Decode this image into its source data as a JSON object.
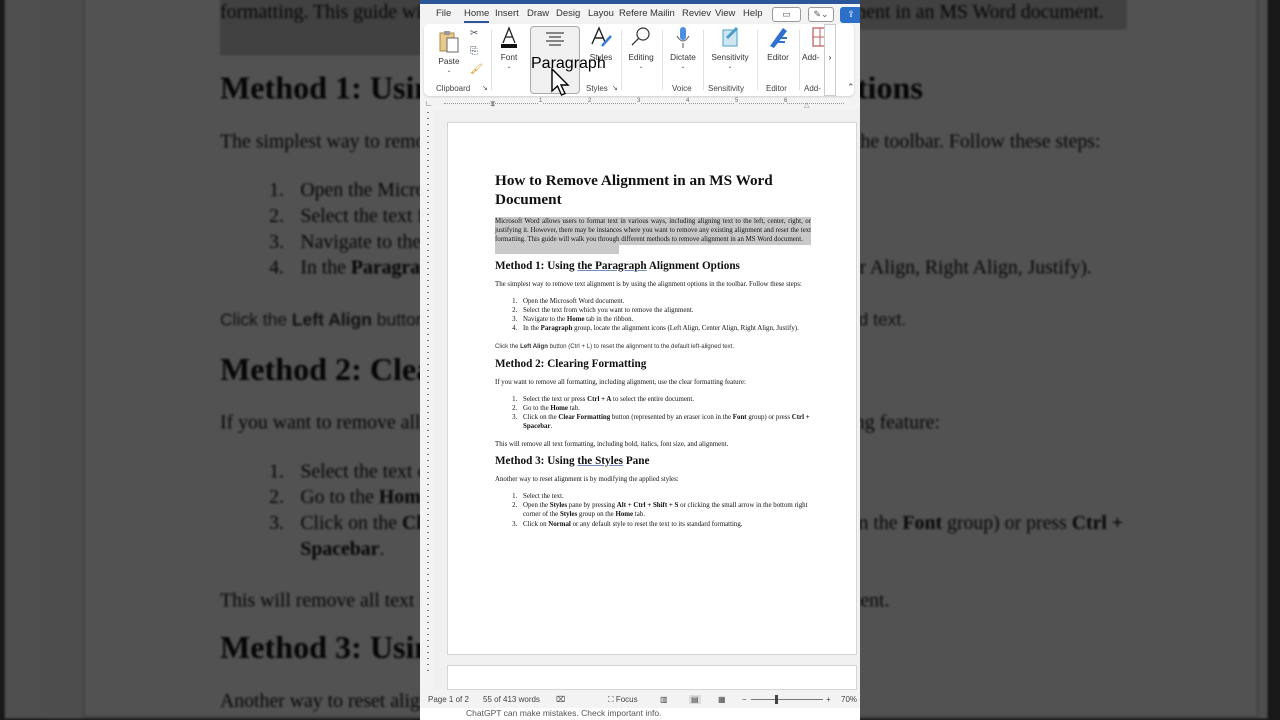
{
  "ribbon_tabs": [
    "File",
    "Home",
    "Insert",
    "Draw",
    "Desig",
    "Layou",
    "Refere",
    "Mailin",
    "Reviev",
    "View",
    "Help"
  ],
  "active_tab": "Home",
  "ribbon": {
    "paste": "Paste",
    "font": "Font",
    "paragraph": "Paragraph",
    "styles": "Styles",
    "editing": "Editing",
    "dictate": "Dictate",
    "sensitivity": "Sensitivity",
    "editor": "Editor",
    "addins": "Add-",
    "groups": {
      "clipboard": "Clipboard",
      "styles": "Styles",
      "voice": "Voice",
      "sensitivity": "Sensitivity",
      "editor": "Editor",
      "addins": "Add-"
    }
  },
  "colors": {
    "accent": "#2b579a",
    "share": "#2b6fc8",
    "selection": "#c9c9c9"
  },
  "document": {
    "title": "How to Remove Alignment in an MS Word Document",
    "intro": "Microsoft Word allows users to format text in various ways, including aligning text to the left, center, right, or justifying it. However, there may be instances where you want to remove any existing alignment and reset the text formatting. This guide will walk you through different methods to remove alignment in an MS Word document.",
    "sections": [
      {
        "heading_pre": "Method 1: Using ",
        "heading_u": "the Paragraph",
        "heading_post": " Alignment Options",
        "lead": "The simplest way to remove text alignment is by using the alignment options in the toolbar. Follow these steps:",
        "steps": [
          [
            {
              "t": "Open the Microsoft Word document."
            }
          ],
          [
            {
              "t": "Select the text from which you want to remove the alignment."
            }
          ],
          [
            {
              "t": "Navigate to the "
            },
            {
              "t": "Home",
              "b": true
            },
            {
              "t": " tab in the ribbon."
            }
          ],
          [
            {
              "t": "In the "
            },
            {
              "t": "Paragraph",
              "b": true
            },
            {
              "t": " group, locate the alignment icons (Left Align, Center Align, Right Align, Justify)."
            }
          ]
        ],
        "note": [
          {
            "t": "Click the "
          },
          {
            "t": "Left Align",
            "b": true
          },
          {
            "t": " button (Ctrl + L) to reset the alignment to the default left-aligned text."
          }
        ]
      },
      {
        "heading_pre": "Method 2: Clearing Formatting",
        "heading_u": "",
        "heading_post": "",
        "lead": "If you want to remove all formatting, including alignment, use the clear formatting feature:",
        "steps": [
          [
            {
              "t": "Select the text or press "
            },
            {
              "t": "Ctrl + A",
              "b": true
            },
            {
              "t": " to select the entire document."
            }
          ],
          [
            {
              "t": "Go to the "
            },
            {
              "t": "Home",
              "b": true
            },
            {
              "t": " tab."
            }
          ],
          [
            {
              "t": "Click on the "
            },
            {
              "t": "Clear Formatting",
              "b": true
            },
            {
              "t": " button (represented by an eraser icon in the "
            },
            {
              "t": "Font",
              "b": true
            },
            {
              "t": " group) or press "
            },
            {
              "t": "Ctrl + Spacebar",
              "b": true
            },
            {
              "t": "."
            }
          ]
        ],
        "after": "This will remove all text formatting, including bold, italics, font size, and alignment."
      },
      {
        "heading_pre": "Method 3: Using ",
        "heading_u": "the Styles",
        "heading_post": " Pane",
        "lead": "Another way to reset alignment is by modifying the applied styles:",
        "steps": [
          [
            {
              "t": "Select the text."
            }
          ],
          [
            {
              "t": "Open the "
            },
            {
              "t": "Styles",
              "b": true
            },
            {
              "t": " pane by pressing "
            },
            {
              "t": "Alt + Ctrl + Shift + S",
              "b": true
            },
            {
              "t": " or clicking the small arrow in the bottom right corner of the "
            },
            {
              "t": "Styles",
              "b": true
            },
            {
              "t": " group on the "
            },
            {
              "t": "Home",
              "b": true
            },
            {
              "t": " tab."
            }
          ],
          [
            {
              "t": "Click on "
            },
            {
              "t": "Normal",
              "b": true
            },
            {
              "t": " or any default style to reset the text to its standard formatting."
            }
          ]
        ]
      }
    ]
  },
  "ruler_numbers": [
    "1",
    "2",
    "3",
    "4",
    "5",
    "6"
  ],
  "status": {
    "page": "Page 1 of 2",
    "words": "55 of 413 words",
    "focus": "Focus",
    "zoom": "70%",
    "zoom_level_percent": 70
  },
  "below_text": "ChatGPT can make mistakes. Check important info."
}
